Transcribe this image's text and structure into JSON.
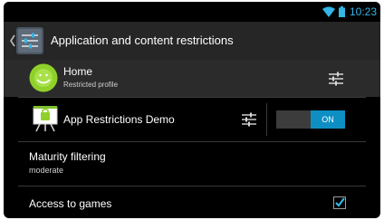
{
  "status_bar": {
    "time": "10:23",
    "wifi_icon": "wifi-icon",
    "battery_icon": "battery-icon",
    "accent_color": "#33b5e5"
  },
  "action_bar": {
    "title": "Application and content restrictions",
    "back_icon": "chevron-left-icon",
    "app_icon": "settings-app-icon",
    "divider_color": "#1f7aa8"
  },
  "rows": {
    "home": {
      "title": "Home",
      "subtitle": "Restricted profile",
      "avatar_icon": "android-avatar-icon",
      "avatar_color": "#8fd12a",
      "action_icon": "settings-sliders-icon"
    },
    "app_restrictions_demo": {
      "title": "App Restrictions Demo",
      "avatar_icon": "presentation-app-icon",
      "action_icon": "settings-sliders-icon",
      "toggle_label": "ON",
      "toggle_on": true,
      "toggle_color": "#0e8fc4"
    },
    "maturity_filtering": {
      "title": "Maturity filtering",
      "value": "moderate"
    },
    "access_to_games": {
      "title": "Access to games",
      "checked": true,
      "check_color": "#33b5e5"
    }
  }
}
